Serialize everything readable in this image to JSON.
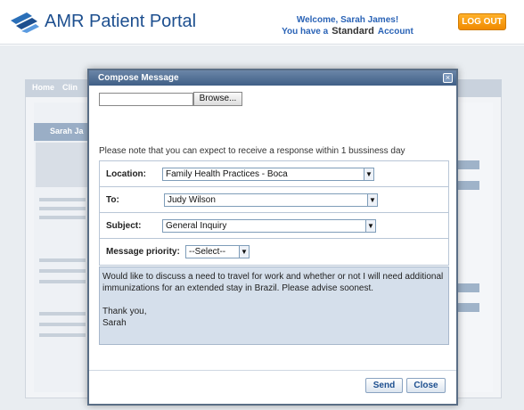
{
  "header": {
    "brand": "AMR Patient Portal",
    "welcome": "Welcome, Sarah James!",
    "account_prefix": "You have a",
    "account_type": "Standard",
    "account_suffix": "Account",
    "logout_label": "LOG OUT"
  },
  "background": {
    "tabs": [
      "Home",
      "Clin"
    ],
    "patient_name_partial": "Sarah Ja"
  },
  "modal": {
    "title": "Compose Message",
    "browse_label": "Browse...",
    "note": "Please note that you can expect to receive a response within 1 bussiness day",
    "fields": {
      "location": {
        "label": "Location:",
        "value": "Family Health Practices - Boca"
      },
      "to": {
        "label": "To:",
        "value": "Judy Wilson"
      },
      "subject": {
        "label": "Subject:",
        "value": "General Inquiry"
      },
      "priority": {
        "label": "Message priority:",
        "value": "--Select--"
      }
    },
    "message": "Would like to discuss a need to travel for work and whether or not I will need additional immunizations for an extended stay in Brazil. Please advise soonest.\n\nThank you,\nSarah",
    "send_label": "Send",
    "close_label": "Close"
  }
}
